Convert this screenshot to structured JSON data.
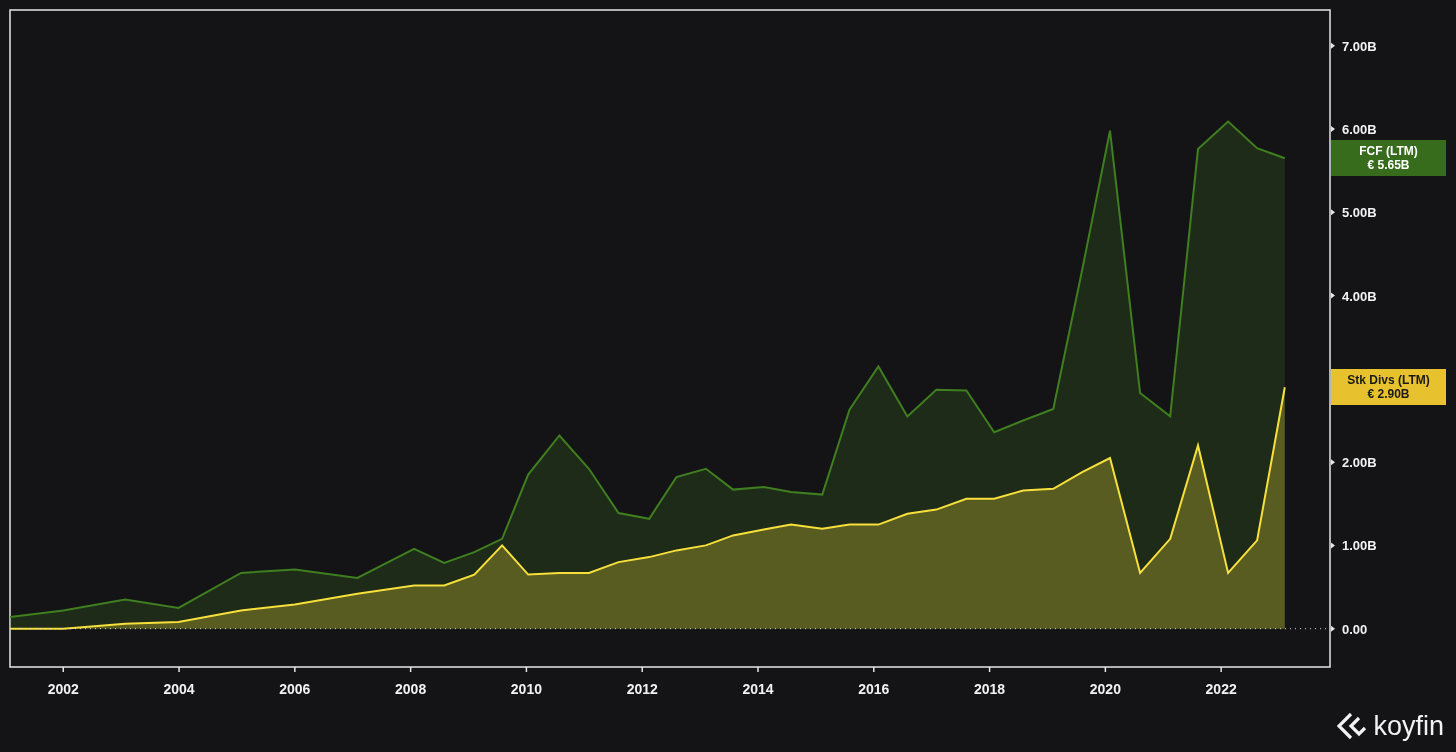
{
  "chart_data": {
    "type": "area",
    "stacked": false,
    "x": [
      2001.08,
      2002.0,
      2003.07,
      2003.99,
      2005.07,
      2006.0,
      2007.08,
      2008.06,
      2008.58,
      2009.1,
      2009.58,
      2010.03,
      2010.57,
      2011.08,
      2011.59,
      2012.12,
      2012.59,
      2013.1,
      2013.57,
      2014.1,
      2014.57,
      2015.11,
      2015.58,
      2016.08,
      2016.58,
      2017.08,
      2017.6,
      2018.08,
      2018.58,
      2019.1,
      2019.6,
      2020.08,
      2020.6,
      2021.12,
      2021.6,
      2022.12,
      2022.62,
      2023.1
    ],
    "series": [
      {
        "name": "FCF (LTM)",
        "color": "#3f7f1f",
        "values": [
          0.14,
          0.22,
          0.35,
          0.25,
          0.67,
          0.71,
          0.61,
          0.96,
          0.79,
          0.92,
          1.08,
          1.85,
          2.32,
          1.92,
          1.39,
          1.32,
          1.82,
          1.92,
          1.67,
          1.7,
          1.64,
          1.61,
          2.63,
          3.15,
          2.55,
          2.87,
          2.86,
          2.36,
          2.5,
          2.64,
          4.31,
          5.98,
          2.83,
          2.55,
          5.76,
          6.09,
          5.77,
          5.65
        ]
      },
      {
        "name": "Stk Divs (LTM)",
        "color": "#f7e03c",
        "values": [
          0.0,
          0.0,
          0.06,
          0.08,
          0.22,
          0.29,
          0.42,
          0.52,
          0.52,
          0.65,
          1.0,
          0.65,
          0.67,
          0.67,
          0.8,
          0.86,
          0.94,
          1.0,
          1.12,
          1.19,
          1.25,
          1.2,
          1.25,
          1.25,
          1.38,
          1.43,
          1.56,
          1.56,
          1.66,
          1.68,
          1.88,
          2.05,
          0.67,
          1.08,
          2.2,
          0.67,
          1.06,
          2.9
        ]
      }
    ],
    "xlim": [
      2001.08,
      2023.88
    ],
    "ylim": [
      -0.46,
      7.43
    ],
    "xticks": [
      2002,
      2004,
      2006,
      2008,
      2010,
      2012,
      2014,
      2016,
      2018,
      2020,
      2022
    ],
    "yticks": [
      {
        "value": 0,
        "label": "0.00"
      },
      {
        "value": 1,
        "label": "1.00B"
      },
      {
        "value": 2,
        "label": "2.00B"
      },
      {
        "value": 4,
        "label": "4.00B"
      },
      {
        "value": 5,
        "label": "5.00B"
      },
      {
        "value": 6,
        "label": "6.00B"
      },
      {
        "value": 7,
        "label": "7.00B"
      }
    ]
  },
  "series_tags": [
    {
      "value": "€ 5.65B",
      "color": "#366c1c"
    },
    {
      "value": "€ 2.90B",
      "color": "#e8c12f"
    }
  ],
  "logo": {
    "text": "koyfin"
  }
}
